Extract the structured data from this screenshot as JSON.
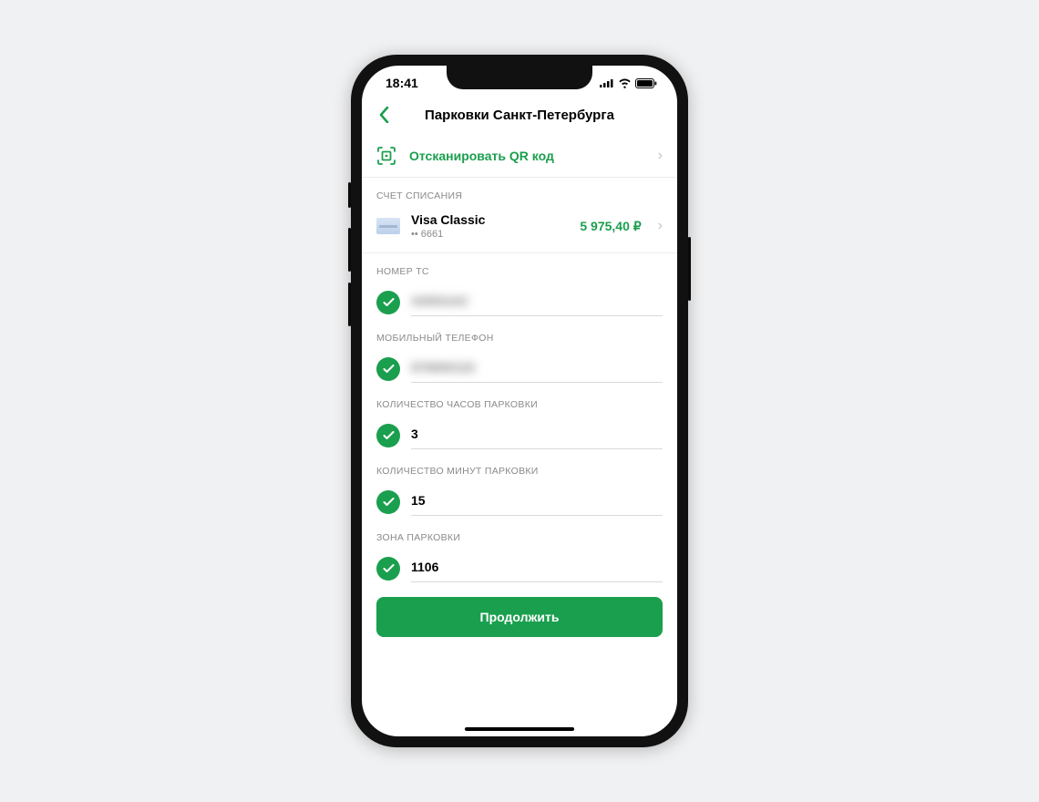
{
  "status": {
    "time": "18:41"
  },
  "header": {
    "title": "Парковки Санкт-Петербурга"
  },
  "qr": {
    "label": "Отсканировать QR код"
  },
  "account": {
    "section_label": "СЧЕТ СПИСАНИЯ",
    "name": "Visa Classic",
    "mask": "•• 6661",
    "amount": "5 975,40 ₽"
  },
  "fields": {
    "vehicle": {
      "label": "НОМЕР ТС",
      "value": "А000ААС"
    },
    "phone": {
      "label": "МОБИЛЬНЫЙ ТЕЛЕФОН",
      "value": "979000123"
    },
    "hours": {
      "label": "КОЛИЧЕСТВО ЧАСОВ ПАРКОВКИ",
      "value": "3"
    },
    "minutes": {
      "label": "КОЛИЧЕСТВО МИНУТ ПАРКОВКИ",
      "value": "15"
    },
    "zone": {
      "label": "ЗОНА ПАРКОВКИ",
      "value": "1106"
    }
  },
  "cta": {
    "label": "Продолжить"
  }
}
